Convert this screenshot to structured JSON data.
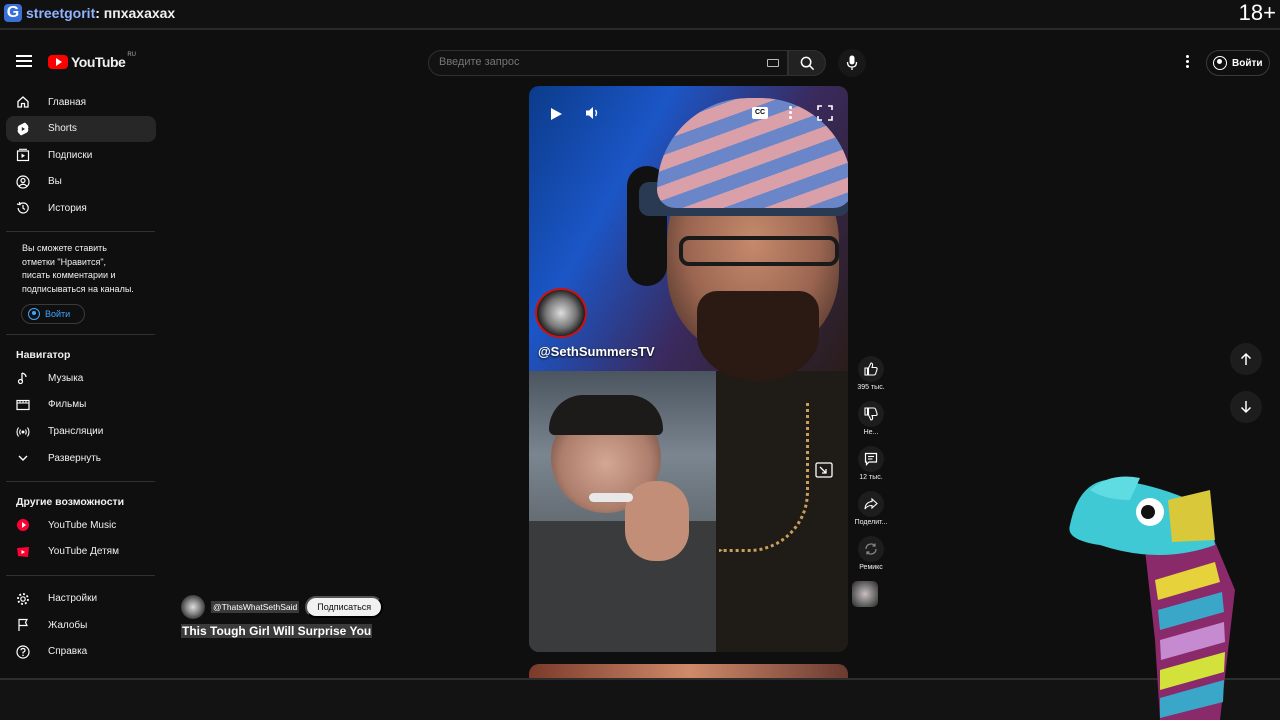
{
  "stream": {
    "channel": "streetgorit",
    "separator": ": ",
    "title": "ппхахахах",
    "age_rating": "18+"
  },
  "youtube": {
    "logo_text": "YouTube",
    "region": "RU",
    "search": {
      "placeholder": "Введите запрос",
      "value": ""
    },
    "signin_label": "Войти",
    "sidebar": {
      "main": [
        {
          "label": "Главная",
          "icon": "home-icon"
        },
        {
          "label": "Shorts",
          "icon": "shorts-icon",
          "active": true
        },
        {
          "label": "Подписки",
          "icon": "subscriptions-icon"
        },
        {
          "label": "Вы",
          "icon": "you-icon"
        },
        {
          "label": "История",
          "icon": "history-icon"
        }
      ],
      "signin_note": "Вы сможете ставить отметки \"Нравится\", писать комментарии и подписываться на каналы.",
      "signin_button": "Войти",
      "navigator_title": "Навигатор",
      "navigator": [
        {
          "label": "Музыка",
          "icon": "music-icon"
        },
        {
          "label": "Фильмы",
          "icon": "movies-icon"
        },
        {
          "label": "Трансляции",
          "icon": "live-icon"
        },
        {
          "label": "Развернуть",
          "icon": "chevron-down-icon"
        }
      ],
      "more_title": "Другие возможности",
      "more": [
        {
          "label": "YouTube Music",
          "icon": "youtube-music-icon"
        },
        {
          "label": "YouTube Детям",
          "icon": "youtube-kids-icon"
        }
      ],
      "settings": [
        {
          "label": "Настройки",
          "icon": "settings-icon"
        },
        {
          "label": "Жалобы",
          "icon": "flag-icon"
        },
        {
          "label": "Справка",
          "icon": "help-icon"
        }
      ]
    },
    "short": {
      "channel_overlay": "@SethSummersTV",
      "cc_label": "CC",
      "author": "@ThatsWhatSethSaid",
      "subscribe_label": "Подписаться",
      "title": "This Tough Girl Will Surprise You",
      "actions": {
        "likes": "395 тыс.",
        "dislike": "Не...",
        "comments": "12 тыс.",
        "share": "Поделит...",
        "remix": "Ремикс"
      }
    }
  },
  "colors": {
    "background": "#0f0f0f",
    "accent_red": "#ff0000",
    "link_blue": "#3ea6ff"
  }
}
